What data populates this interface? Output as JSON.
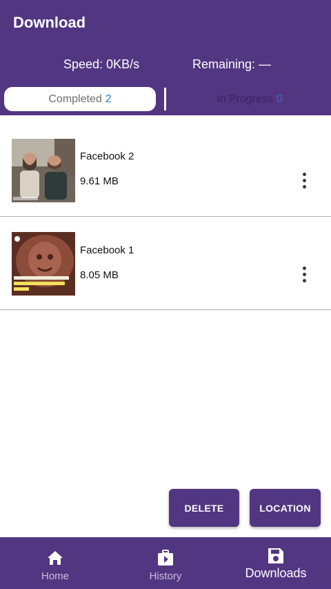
{
  "header": {
    "title": "Download",
    "speed": "Speed: 0KB/s",
    "remaining": "Remaining: —"
  },
  "tabs": {
    "completed_label": "Completed",
    "completed_count": "2",
    "in_progress_label": "In Progress",
    "in_progress_count": "0"
  },
  "downloads": [
    {
      "name": "Facebook 2",
      "size": "9.61 MB"
    },
    {
      "name": "Facebook 1",
      "size": "8.05 MB"
    }
  ],
  "actions": {
    "delete": "DELETE",
    "location": "LOCATION"
  },
  "bottom_nav": [
    {
      "label": "Home",
      "icon": "home-icon"
    },
    {
      "label": "History",
      "icon": "history-icon"
    },
    {
      "label": "Downloads",
      "icon": "downloads-icon",
      "active": true
    }
  ],
  "colors": {
    "primary": "#523681",
    "accent": "#2f7fc2"
  }
}
